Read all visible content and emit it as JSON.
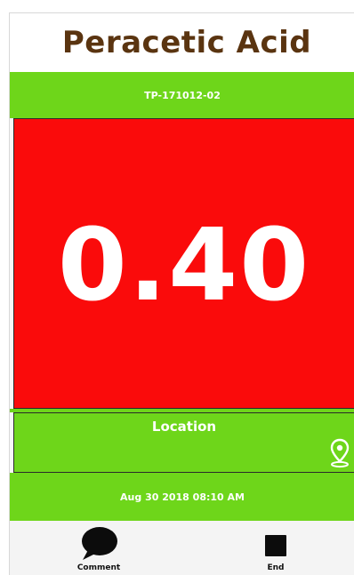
{
  "header": {
    "title": "Peracetic Acid"
  },
  "sensor": {
    "id": "TP-171012-02"
  },
  "reading": {
    "value": "0.40",
    "status_color": "#fa0b0b"
  },
  "location": {
    "label": "Location",
    "icon": "map-pin-icon"
  },
  "timestamp": {
    "text": "Aug 30 2018 08:10 AM"
  },
  "nav": {
    "comment": {
      "label": "Comment",
      "icon": "speech-bubble-icon"
    },
    "end": {
      "label": "End",
      "icon": "stop-icon"
    }
  },
  "theme": {
    "accent_green": "#6ed61a",
    "title_brown": "#5a3410"
  }
}
